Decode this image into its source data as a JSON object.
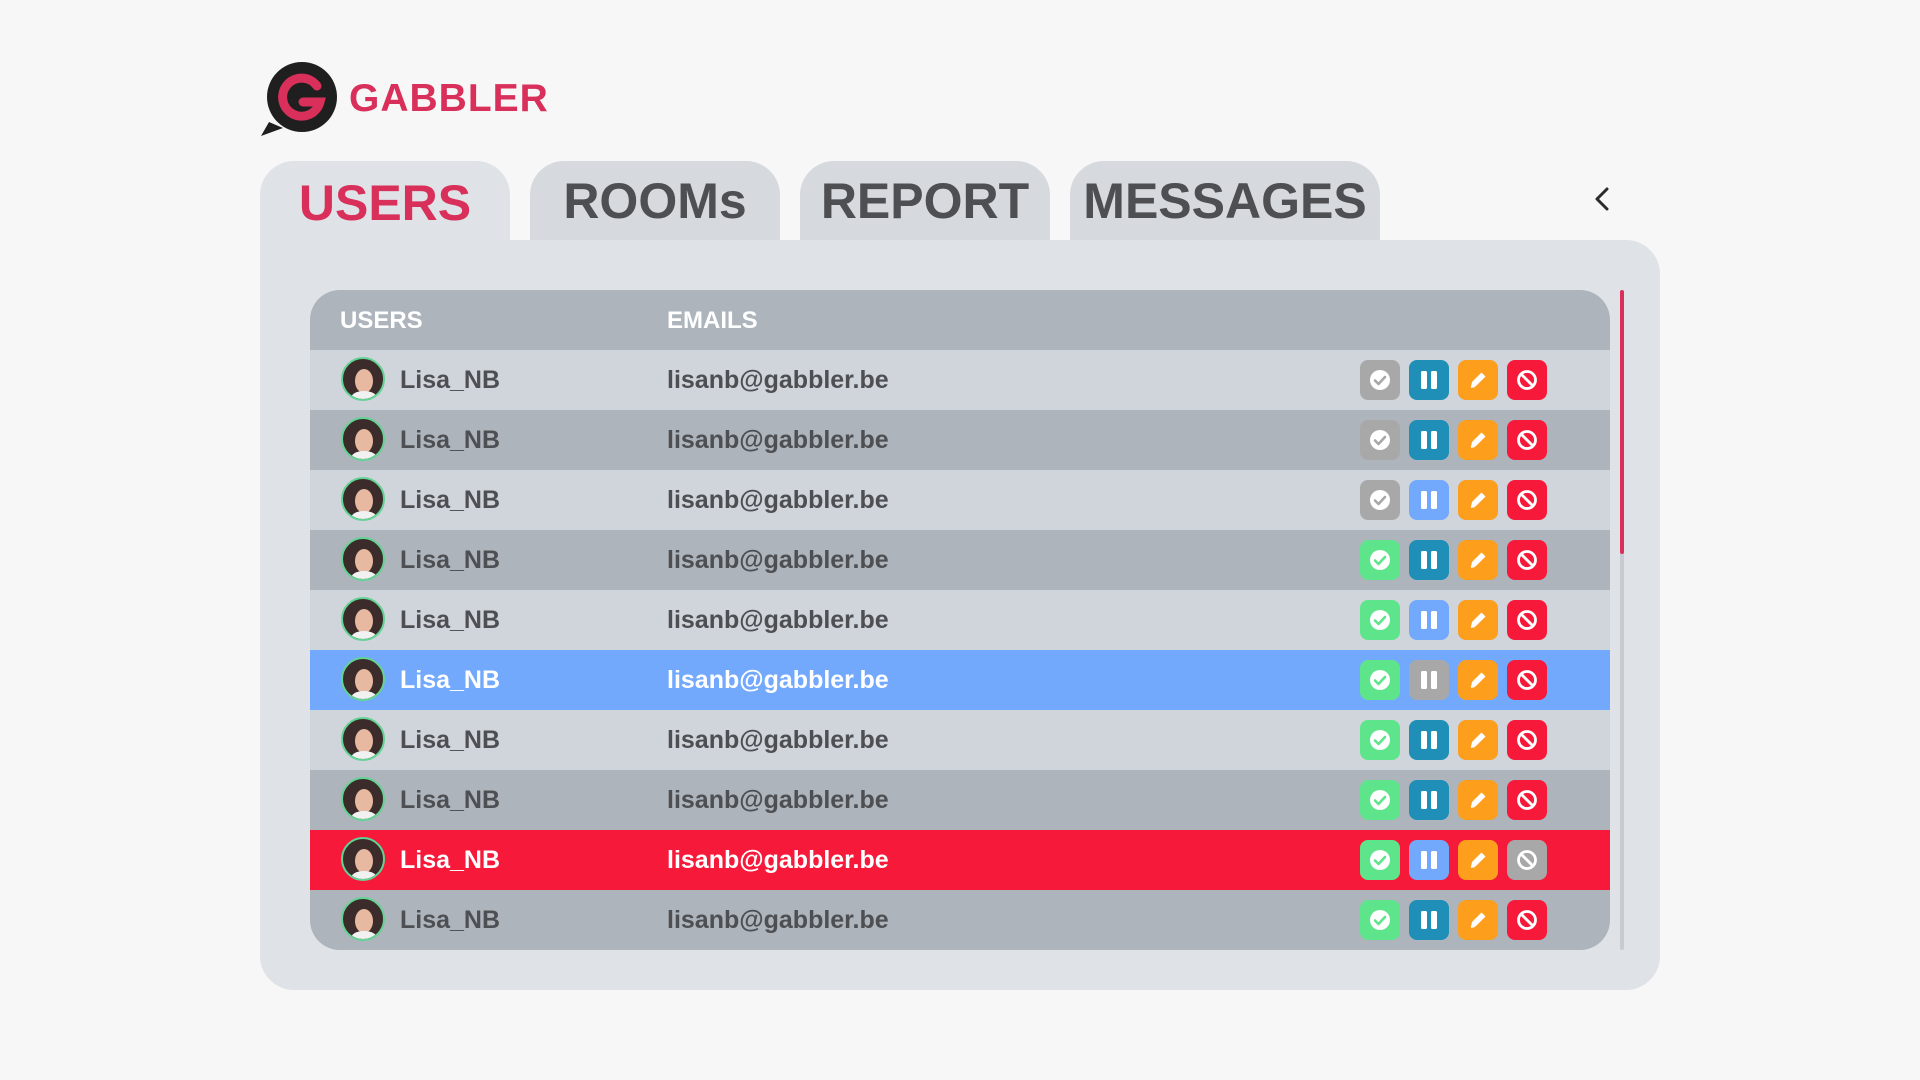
{
  "app": {
    "name": "GABBLER",
    "brand_color": "#d8305a"
  },
  "tabs": [
    {
      "label": "USERS",
      "active": true
    },
    {
      "label": "ROOMs",
      "active": false
    },
    {
      "label": "REPORT",
      "active": false
    },
    {
      "label": "MESSAGES",
      "active": false
    }
  ],
  "collapse_icon": "chevron-left-icon",
  "table": {
    "headers": {
      "users": "USERS",
      "emails": "EMAILS"
    },
    "rows": [
      {
        "username": "Lisa_NB",
        "email": "lisanb@gabbler.be",
        "highlight": "none",
        "approve": "inactive",
        "pause": "active",
        "edit": "active",
        "ban": "active"
      },
      {
        "username": "Lisa_NB",
        "email": "lisanb@gabbler.be",
        "highlight": "none",
        "approve": "inactive",
        "pause": "active",
        "edit": "active",
        "ban": "active"
      },
      {
        "username": "Lisa_NB",
        "email": "lisanb@gabbler.be",
        "highlight": "none",
        "approve": "inactive",
        "pause": "light",
        "edit": "active",
        "ban": "active"
      },
      {
        "username": "Lisa_NB",
        "email": "lisanb@gabbler.be",
        "highlight": "none",
        "approve": "active",
        "pause": "active",
        "edit": "active",
        "ban": "active"
      },
      {
        "username": "Lisa_NB",
        "email": "lisanb@gabbler.be",
        "highlight": "none",
        "approve": "active",
        "pause": "light",
        "edit": "active",
        "ban": "active"
      },
      {
        "username": "Lisa_NB",
        "email": "lisanb@gabbler.be",
        "highlight": "blue",
        "approve": "active",
        "pause": "inactive",
        "edit": "active",
        "ban": "active"
      },
      {
        "username": "Lisa_NB",
        "email": "lisanb@gabbler.be",
        "highlight": "none",
        "approve": "active",
        "pause": "active",
        "edit": "active",
        "ban": "active"
      },
      {
        "username": "Lisa_NB",
        "email": "lisanb@gabbler.be",
        "highlight": "none",
        "approve": "active",
        "pause": "active",
        "edit": "active",
        "ban": "active"
      },
      {
        "username": "Lisa_NB",
        "email": "lisanb@gabbler.be",
        "highlight": "red",
        "approve": "active",
        "pause": "light",
        "edit": "active",
        "ban": "inactive"
      },
      {
        "username": "Lisa_NB",
        "email": "lisanb@gabbler.be",
        "highlight": "none",
        "approve": "active",
        "pause": "active",
        "edit": "active",
        "ban": "active"
      }
    ],
    "action_icons": [
      "check-circle-icon",
      "pause-icon",
      "pencil-icon",
      "ban-icon"
    ]
  },
  "colors": {
    "approve_active": "#5ee58c",
    "approve_inactive": "#a8a8a8",
    "pause_active": "#1f8fb8",
    "pause_light": "#72a9fd",
    "pause_inactive": "#a8a8a8",
    "edit_active": "#fd9e1d",
    "ban_active": "#f71939",
    "ban_inactive": "#a8a8a8",
    "row_highlight_blue": "#72a9fd",
    "row_highlight_red": "#f71939"
  }
}
